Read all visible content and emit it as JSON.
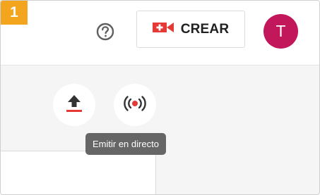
{
  "step": {
    "number": "1"
  },
  "header": {
    "help_icon": "help-circle-icon",
    "create_button": {
      "label": "CREAR",
      "icon": "video-camera-plus-icon"
    },
    "avatar": {
      "initial": "T",
      "color": "#c2185b"
    }
  },
  "actions": {
    "upload": {
      "icon": "upload-icon"
    },
    "live": {
      "icon": "live-broadcast-icon"
    }
  },
  "tooltip": {
    "text": "Emitir en directo"
  },
  "colors": {
    "badge": "#f3a51e",
    "accent_red": "#d32f2f",
    "tooltip_bg": "#666666"
  }
}
